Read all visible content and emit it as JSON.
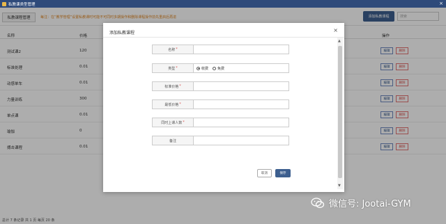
{
  "window": {
    "title": "私教课类型管理"
  },
  "toolbar": {
    "tab_label": "私教课程管理",
    "notice": "每注：在“教学管理”设置私教课时可能不可同时多期操作和删除课程操作前先重启后再进",
    "add_button_label": "添加私教课程",
    "search_placeholder": "搜索"
  },
  "table": {
    "headers": {
      "name": "名称",
      "price": "价格",
      "action": "操作"
    },
    "rows": [
      {
        "name": "测试课2",
        "price": "120",
        "edit": "编辑",
        "delete": "删除"
      },
      {
        "name": "标准处理",
        "price": "0.01",
        "edit": "编辑",
        "delete": "删除"
      },
      {
        "name": "动感单车",
        "price": "0.01",
        "edit": "编辑",
        "delete": "删除"
      },
      {
        "name": "力量训练",
        "price": "300",
        "edit": "编辑",
        "delete": "删除"
      },
      {
        "name": "单点课",
        "price": "0.01",
        "edit": "编辑",
        "delete": "删除"
      },
      {
        "name": "瑜伽",
        "price": "0",
        "edit": "编辑",
        "delete": "删除"
      },
      {
        "name": "搏击课程",
        "price": "0.01",
        "edit": "编辑",
        "delete": "删除"
      }
    ]
  },
  "footer": {
    "text": "总计 7 条记录 共 1 页 每页 20 条"
  },
  "modal": {
    "title": "添加私教课程",
    "fields": {
      "name": {
        "label": "名称",
        "required": "*",
        "value": ""
      },
      "type": {
        "label": "类型",
        "required": "*",
        "option_paid": "收费",
        "option_free": "免费",
        "selected": "收费"
      },
      "standard_price": {
        "label": "标准价格",
        "required": "*",
        "value": ""
      },
      "lowest_price": {
        "label": "最低价格",
        "required": "*",
        "value": ""
      },
      "capacity": {
        "label": "同时上课人数",
        "required": "*",
        "value": ""
      },
      "remark": {
        "label": "备注",
        "value": ""
      }
    },
    "cancel_label": "取消",
    "save_label": "保存"
  },
  "watermark": {
    "text": "微信号: Jootai-GYM"
  },
  "colors": {
    "primary": "#3d5f8f",
    "titlebar": "#2e4a7a",
    "danger": "#d9534f",
    "notice": "#e08a2a"
  }
}
